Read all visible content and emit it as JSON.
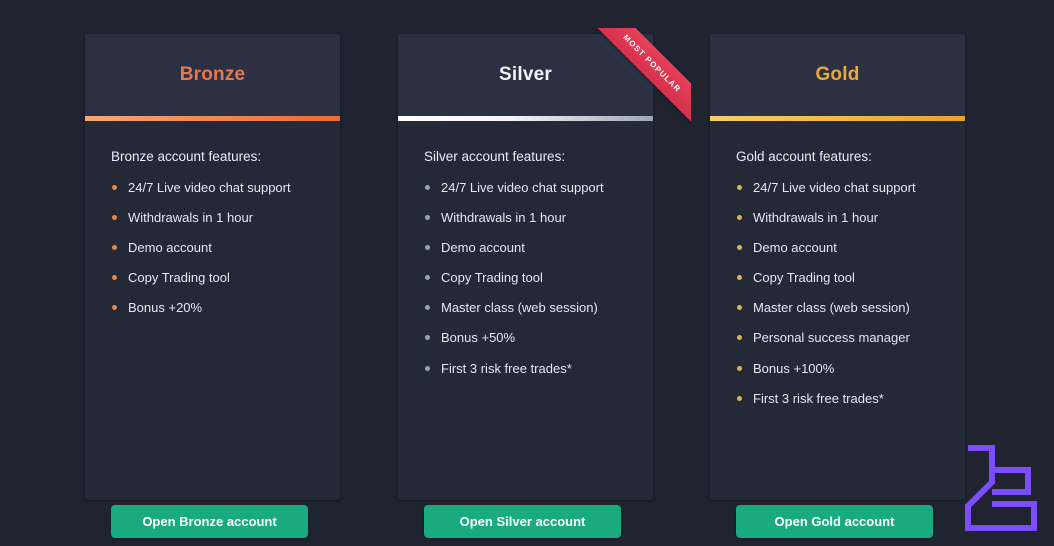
{
  "theme": {
    "page_background": "#1f2430",
    "card_header_background": "#2b3142",
    "card_body_background": "#242938",
    "button_color": "#19ab7e",
    "ribbon_color": "#e8405a",
    "logo_color": "#7c4dff"
  },
  "plans": [
    {
      "id": "bronze",
      "title": "Bronze",
      "title_color": "#e8784a",
      "features_heading": "Bronze account features:",
      "features": [
        "24/7 Live video chat support",
        "Withdrawals in 1 hour",
        "Demo account",
        "Copy Trading tool",
        "Bonus +20%"
      ],
      "cta_label": "Open Bronze account",
      "badge": null
    },
    {
      "id": "silver",
      "title": "Silver",
      "title_color": "#f2f4f8",
      "features_heading": "Silver account features:",
      "features": [
        "24/7 Live video chat support",
        "Withdrawals in 1 hour",
        "Demo account",
        "Copy Trading tool",
        "Master class (web session)",
        "Bonus +50%",
        "First 3 risk free trades*"
      ],
      "cta_label": "Open Silver account",
      "badge": "MOST POPULAR"
    },
    {
      "id": "gold",
      "title": "Gold",
      "title_color": "#e8a940",
      "features_heading": "Gold account features:",
      "features": [
        "24/7 Live video chat support",
        "Withdrawals in 1 hour",
        "Demo account",
        "Copy Trading tool",
        "Master class (web session)",
        "Personal success manager",
        "Bonus +100%",
        "First 3 risk free trades*"
      ],
      "cta_label": "Open Gold account",
      "badge": null
    }
  ],
  "logo": {
    "icon": "brand-logo-icon"
  }
}
